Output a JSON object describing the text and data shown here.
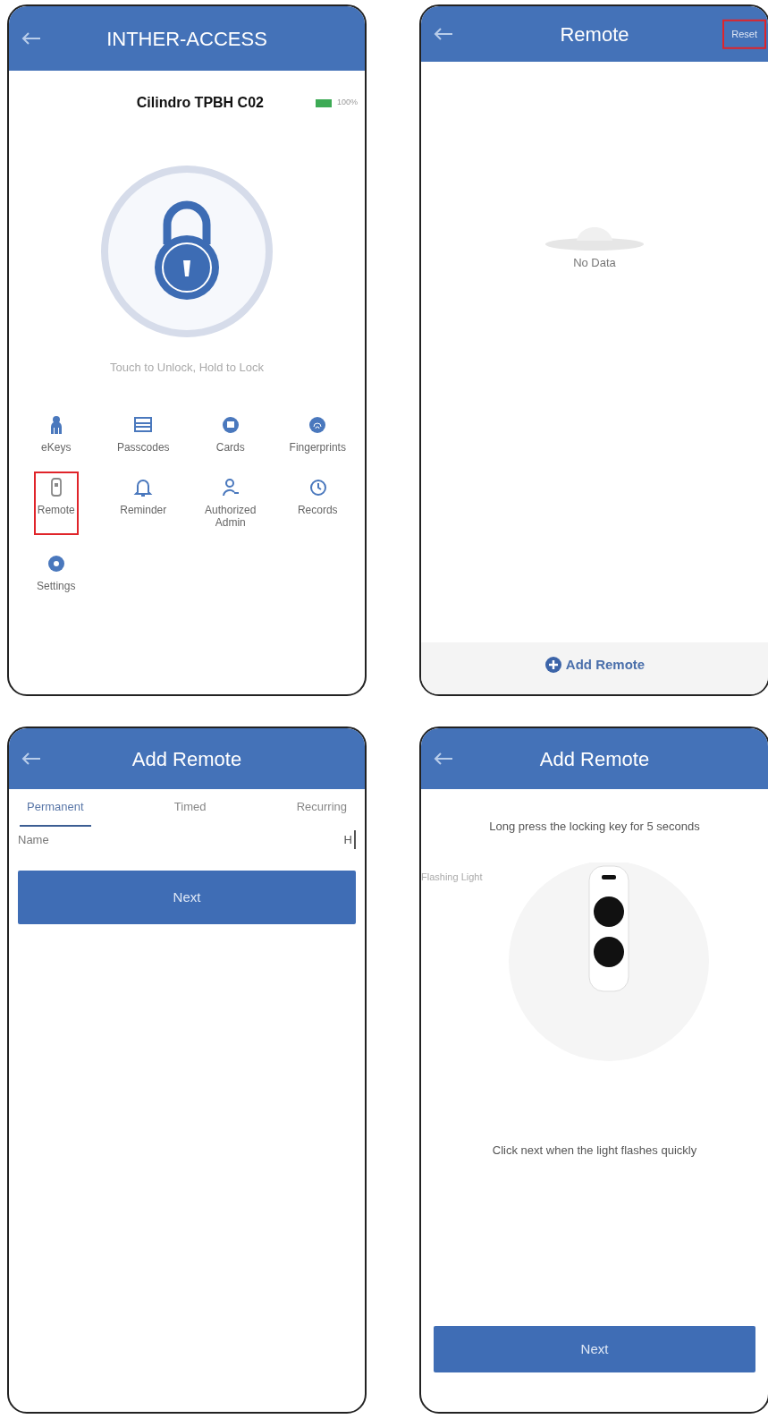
{
  "screens": [
    {
      "kind": "home",
      "header": {
        "title": "INTHER-ACCESS"
      },
      "lock_name": "Cilindro TPBH C02",
      "battery_reading": "100%",
      "hint": "Touch to Unlock, Hold to Lock",
      "menu": [
        {
          "label": "eKeys",
          "kind": "person",
          "highlighted": false
        },
        {
          "label": "Passcodes",
          "kind": "passcode",
          "highlighted": false
        },
        {
          "label": "Cards",
          "kind": "card",
          "highlighted": false
        },
        {
          "label": "Fingerprints",
          "kind": "fingerprint",
          "highlighted": false
        },
        {
          "label": "Remote",
          "kind": "remote",
          "highlighted": true
        },
        {
          "label": "Reminder",
          "kind": "bell",
          "highlighted": false
        },
        {
          "label": "Authorized Admin",
          "kind": "admin",
          "highlighted": false
        },
        {
          "label": "Records",
          "kind": "clock",
          "highlighted": false
        },
        {
          "label": "Settings",
          "kind": "gear",
          "highlighted": false
        }
      ]
    },
    {
      "kind": "list",
      "header": {
        "title": "Remote",
        "action": {
          "label": "Reset",
          "highlighted": true
        }
      },
      "empty_text": "No Data",
      "add_button": "Add Remote"
    },
    {
      "kind": "form",
      "header": {
        "title": "Add Remote"
      },
      "tabs": [
        {
          "label": "Permanent",
          "selected": true
        },
        {
          "label": "Timed",
          "selected": false
        },
        {
          "label": "Recurring",
          "selected": false
        }
      ],
      "fields": [
        {
          "label": "Name",
          "value": "H"
        }
      ],
      "button": "Next"
    },
    {
      "kind": "instructions",
      "header": {
        "title": "Add Remote"
      },
      "instruction": "Long press the locking key for 5 seconds",
      "light_label": "Flashing Light",
      "note": "Click next when the light flashes quickly",
      "button": "Next"
    }
  ]
}
